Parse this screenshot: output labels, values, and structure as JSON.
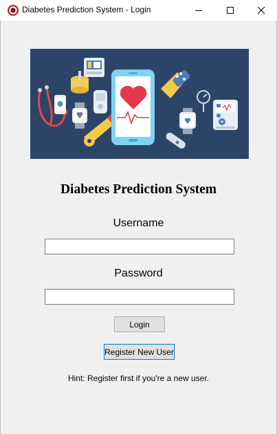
{
  "window": {
    "title": "Diabetes Prediction System - Login",
    "icon": "red-circle-app-icon",
    "controls": [
      "minimize-icon",
      "maximize-icon",
      "close-icon"
    ]
  },
  "banner": {
    "description_icons": [
      "stethoscope-icon",
      "smartphone-heart-icon",
      "smartwatch-icon",
      "thermometer-icon",
      "fitness-band-icon",
      "blood-pressure-monitor-icon",
      "pill-bottle-icon",
      "glucometer-icon"
    ],
    "colors": {
      "background": "#2c4468",
      "phone": "#7fd3f2",
      "heart": "#e53a4b",
      "yellow": "#f7c948"
    }
  },
  "app_title": "Diabetes Prediction System",
  "form": {
    "username_label": "Username",
    "username_value": "",
    "password_label": "Password",
    "password_value": "",
    "login_label": "Login",
    "register_label": "Register New User"
  },
  "hint": "Hint: Register first if you're a new user."
}
